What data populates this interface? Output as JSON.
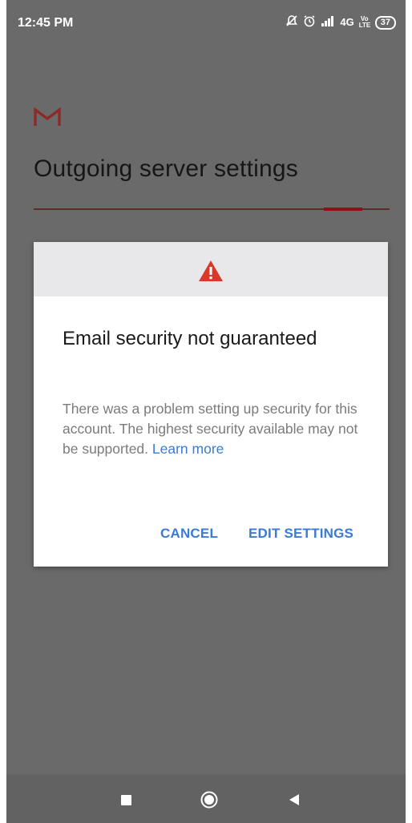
{
  "status_bar": {
    "time": "12:45 PM",
    "icons": [
      "muted-icon",
      "alarm-icon",
      "signal-icon",
      "4g-icon",
      "volte-icon",
      "battery-icon"
    ],
    "network": "4G",
    "volte": "Vo LTE",
    "battery_level": "37"
  },
  "app": {
    "logo": "gmail-logo",
    "title": "Outgoing server settings",
    "progress": 0.9
  },
  "dialog": {
    "icon": "warning-icon",
    "title": "Email security not guaranteed",
    "body": "There was a problem setting up security for this account. The highest security available may not be supported.",
    "link": "Learn more",
    "cancel_label": "CANCEL",
    "edit_label": "EDIT SETTINGS"
  },
  "nav_bar": {
    "buttons": [
      "recent-apps-icon",
      "home-icon",
      "back-icon"
    ]
  },
  "colors": {
    "scrim": "#6a6a6a",
    "accent_blue": "#3a7bd5",
    "warning_red": "#d9392a",
    "progress_red": "#8a1414"
  }
}
